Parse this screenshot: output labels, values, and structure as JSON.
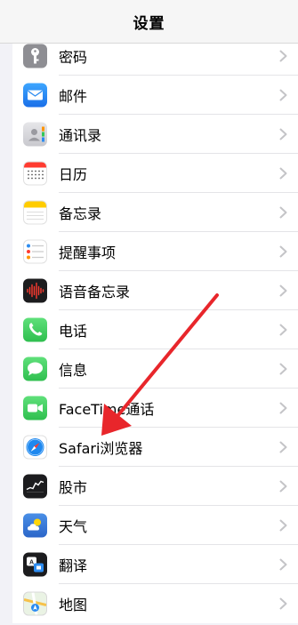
{
  "nav": {
    "title": "设置"
  },
  "rows": [
    {
      "label": "密码",
      "icon": "key-icon",
      "color": "#8e8e93"
    },
    {
      "label": "邮件",
      "icon": "mail-icon",
      "color": "#2d8cf0"
    },
    {
      "label": "通讯录",
      "icon": "contacts-icon",
      "color": "#d1d1d6"
    },
    {
      "label": "日历",
      "icon": "calendar-icon",
      "color": "#ffffff"
    },
    {
      "label": "备忘录",
      "icon": "notes-icon",
      "color": "#ffffff"
    },
    {
      "label": "提醒事项",
      "icon": "reminders-icon",
      "color": "#ffffff"
    },
    {
      "label": "语音备忘录",
      "icon": "voice-memos-icon",
      "color": "#1c1c1e"
    },
    {
      "label": "电话",
      "icon": "phone-icon",
      "color": "#34c759"
    },
    {
      "label": "信息",
      "icon": "messages-icon",
      "color": "#34c759"
    },
    {
      "label": "FaceTime通话",
      "icon": "facetime-icon",
      "color": "#34c759"
    },
    {
      "label": "Safari浏览器",
      "icon": "safari-icon",
      "color": "#ffffff"
    },
    {
      "label": "股市",
      "icon": "stocks-icon",
      "color": "#1c1c1e"
    },
    {
      "label": "天气",
      "icon": "weather-icon",
      "color": "#3d7bd9"
    },
    {
      "label": "翻译",
      "icon": "translate-icon",
      "color": "#1c1c1e"
    },
    {
      "label": "地图",
      "icon": "maps-icon",
      "color": "#eaf3e4"
    }
  ],
  "annotation": {
    "arrow-color": "#e8262b"
  }
}
